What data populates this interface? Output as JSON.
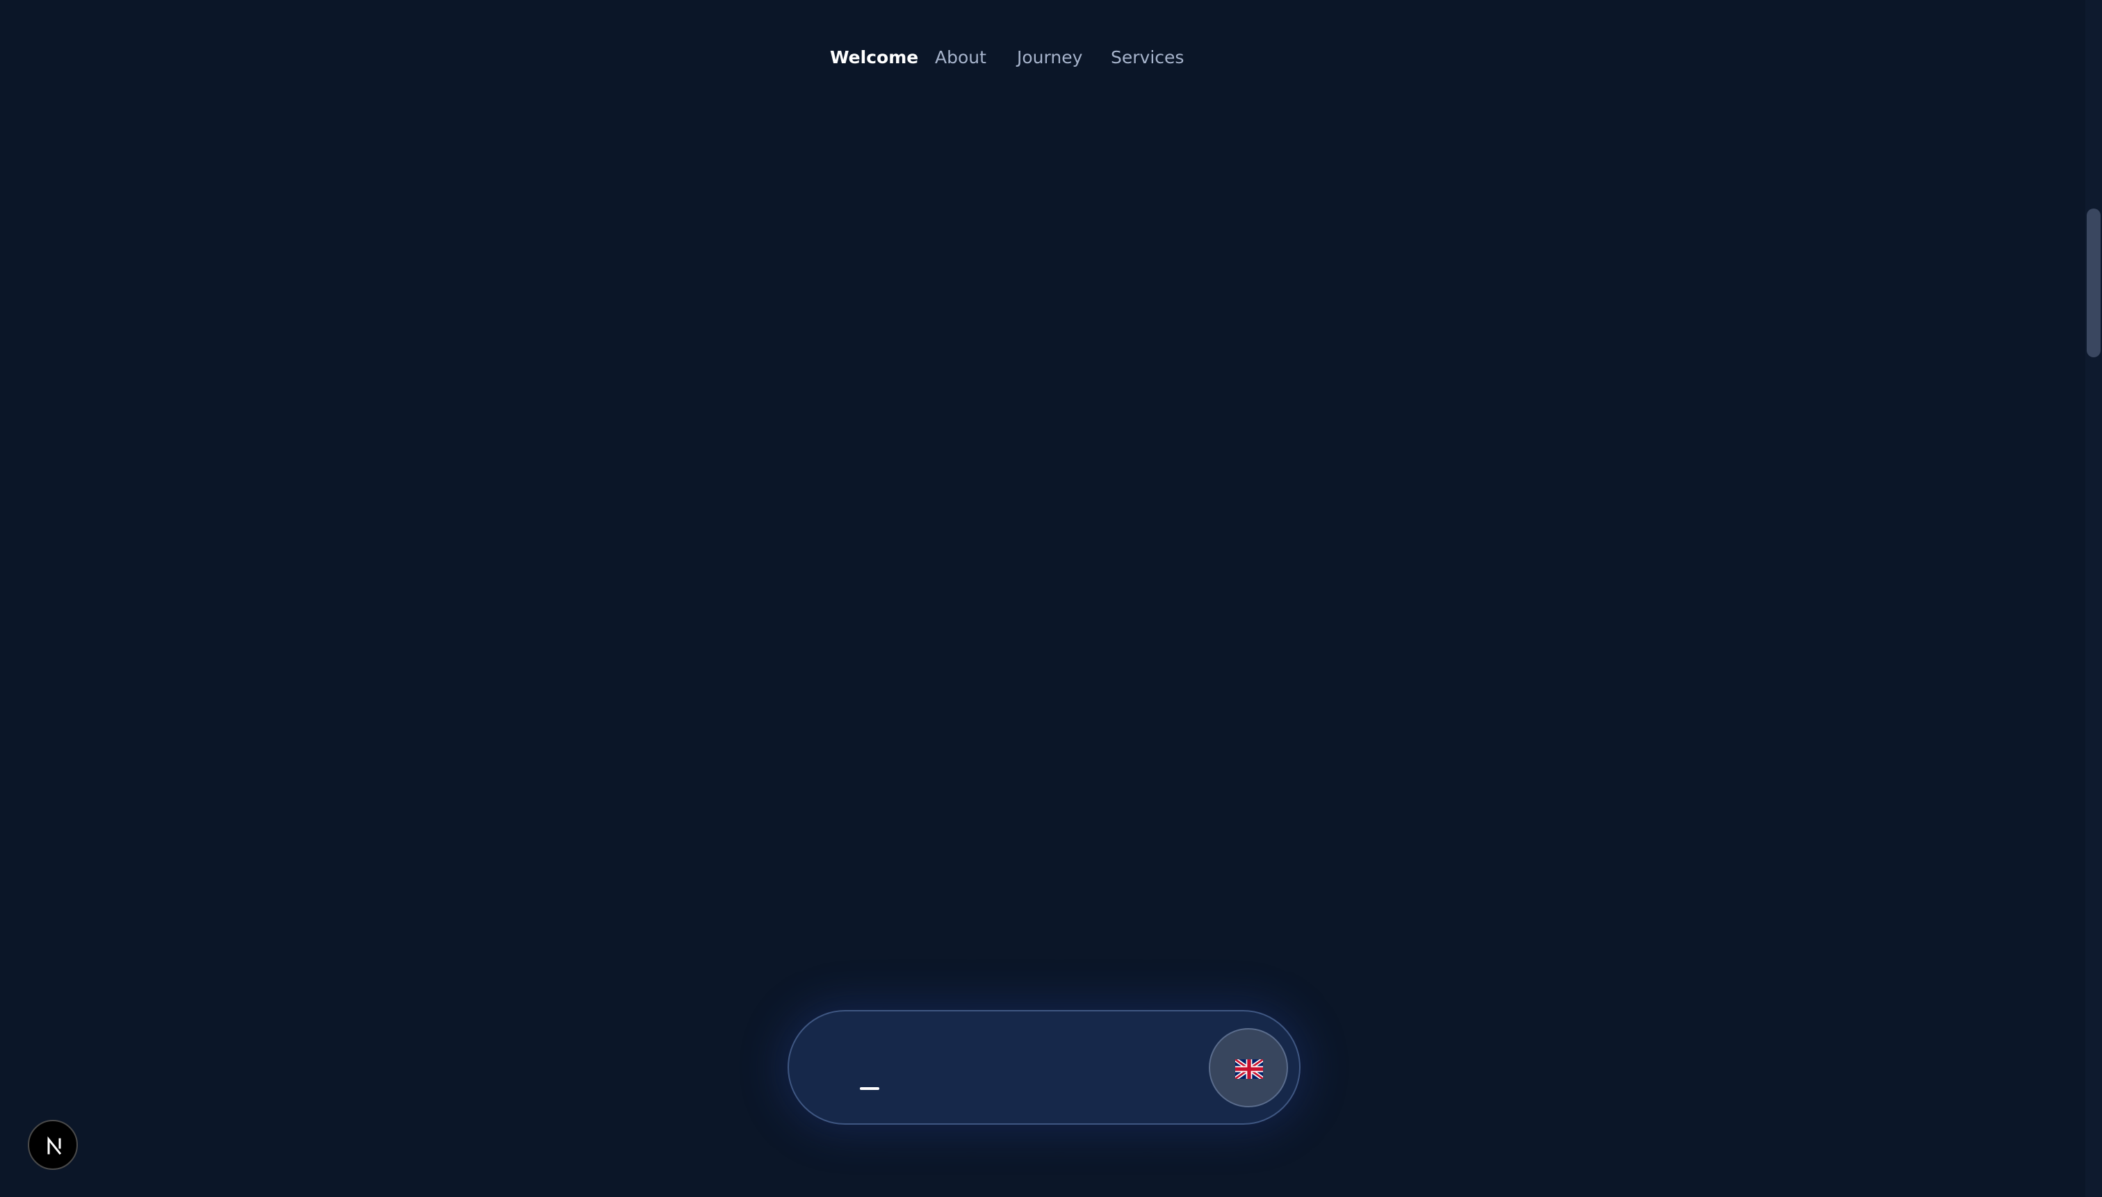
{
  "nav": {
    "items": [
      {
        "label": "Welcome",
        "active": true
      },
      {
        "label": "About",
        "active": false
      },
      {
        "label": "Journey",
        "active": false
      },
      {
        "label": "Services",
        "active": false
      }
    ],
    "language": {
      "icon": "uk-flag-icon"
    }
  },
  "badge": {
    "icon": "nextjs-logo-icon"
  },
  "colors": {
    "background": "#0b1628",
    "nav_background": "#16284a",
    "nav_border": "#3f5782",
    "active_text": "#ffffff",
    "inactive_text": "#a7b4cc"
  }
}
